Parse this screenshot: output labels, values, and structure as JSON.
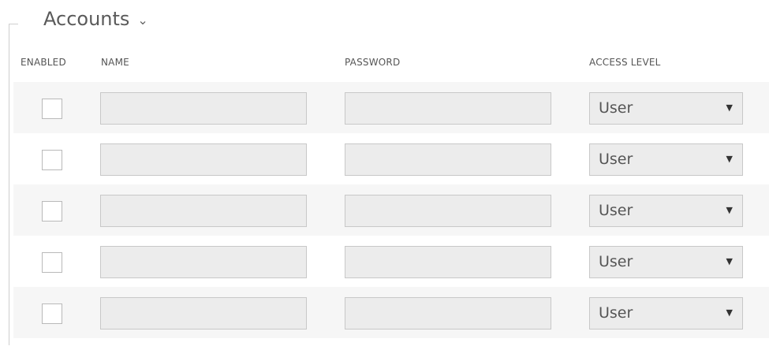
{
  "section": {
    "title": "Accounts",
    "toggle_icon": "chevron-down-icon"
  },
  "columns": {
    "enabled": "ENABLED",
    "name": "NAME",
    "password": "PASSWORD",
    "access_level": "ACCESS LEVEL"
  },
  "rows": [
    {
      "enabled": false,
      "name": "",
      "password": "",
      "access_level": "User"
    },
    {
      "enabled": false,
      "name": "",
      "password": "",
      "access_level": "User"
    },
    {
      "enabled": false,
      "name": "",
      "password": "",
      "access_level": "User"
    },
    {
      "enabled": false,
      "name": "",
      "password": "",
      "access_level": "User"
    },
    {
      "enabled": false,
      "name": "",
      "password": "",
      "access_level": "User"
    }
  ],
  "colors": {
    "input_background": "#ececec",
    "row_alt_background": "#f6f6f6",
    "border": "#c8c8c8"
  }
}
